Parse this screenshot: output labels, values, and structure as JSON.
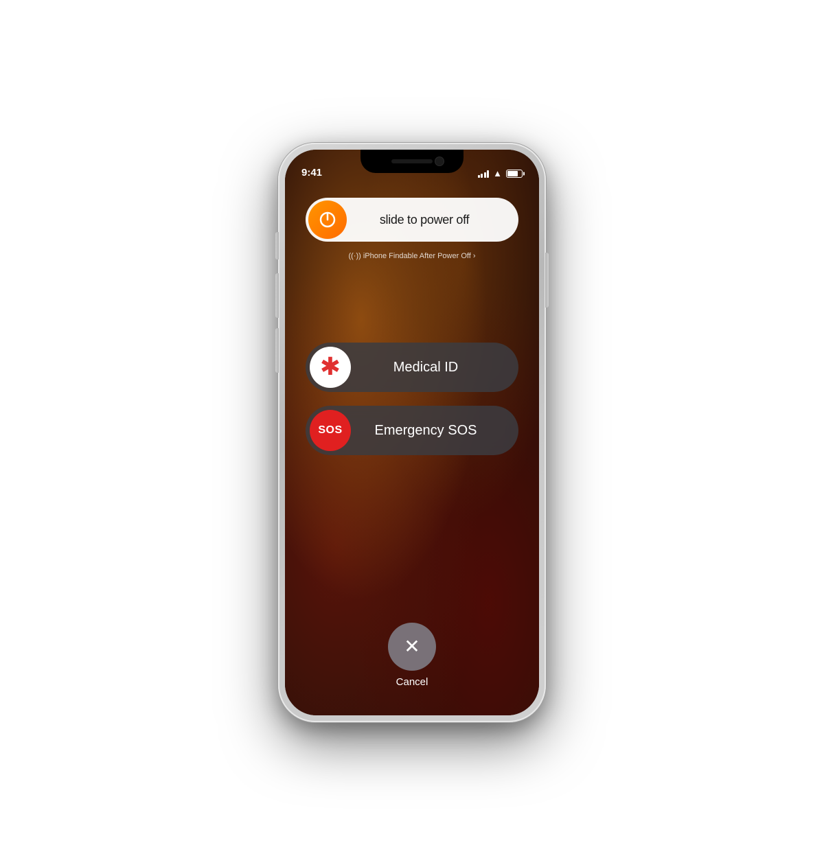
{
  "phone": {
    "status_bar": {
      "time": "9:41"
    },
    "power_slider": {
      "text": "slide to power off"
    },
    "findable": {
      "text": "iPhone Findable After Power Off ›",
      "prefix": "((·))"
    },
    "medical_slider": {
      "text": "Medical ID",
      "icon": "*"
    },
    "sos_slider": {
      "text": "Emergency SOS",
      "badge": "SOS"
    },
    "cancel": {
      "icon": "✕",
      "label": "Cancel"
    }
  }
}
